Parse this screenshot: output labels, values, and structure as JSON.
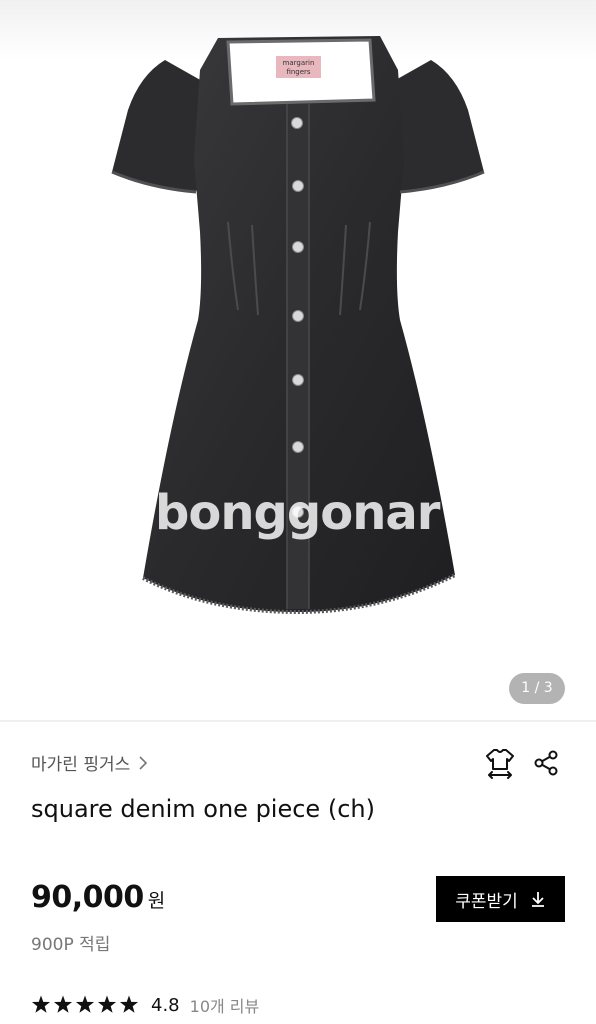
{
  "gallery": {
    "watermark": "bonggonar",
    "tag_line1": "margarin",
    "tag_line2": "fingers",
    "counter": "1 / 3"
  },
  "product": {
    "brand": "마가린 핑거스",
    "title": "square denim one piece (ch)",
    "price": "90,000",
    "currency": "원",
    "points": "900P 적립",
    "coupon_label": "쿠폰받기",
    "rating": "4.8",
    "rating_stars": 5,
    "review_count": "10개 리뷰"
  },
  "icons": {
    "size_guide": "tshirt-size-icon",
    "share": "share-icon",
    "brand_chevron": "chevron-right-icon",
    "coupon": "download-icon"
  },
  "colors": {
    "denim": "#2b2b2d",
    "coupon_bg": "#000000",
    "counter_bg": "#b3b3b3"
  }
}
